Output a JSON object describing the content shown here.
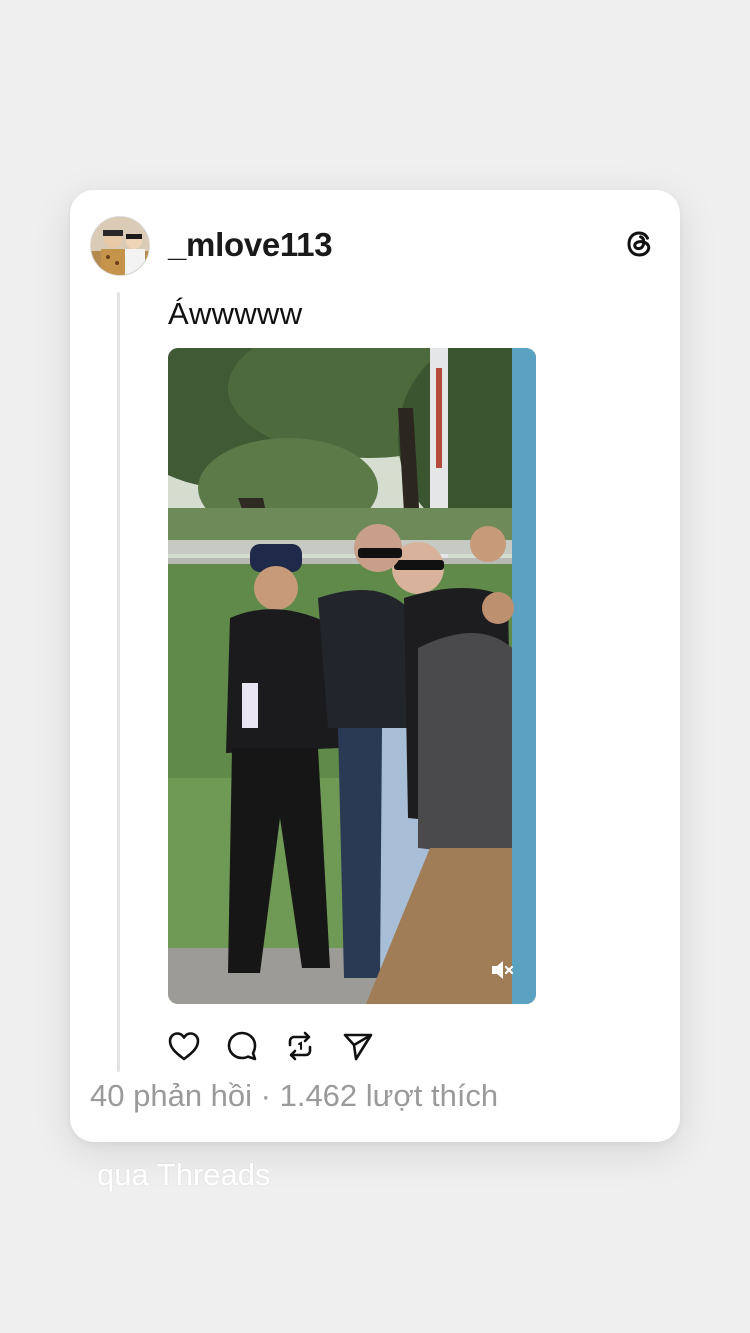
{
  "post": {
    "username": "_mlove113",
    "text": "Áwwwww",
    "stats": "40 phản hồi · 1.462 lượt thích"
  },
  "icons": {
    "avatar": "avatar-photo",
    "brand": "threads-logo-icon",
    "media_overlay": "mute-icon",
    "actions": [
      "heart-icon",
      "comment-icon",
      "repost-icon",
      "send-icon"
    ]
  },
  "footer": {
    "via_label": "qua Threads"
  },
  "colors": {
    "background": "#efefef",
    "card": "#ffffff",
    "stats_text": "#9a9a9a",
    "username": "#1a1a1a"
  }
}
